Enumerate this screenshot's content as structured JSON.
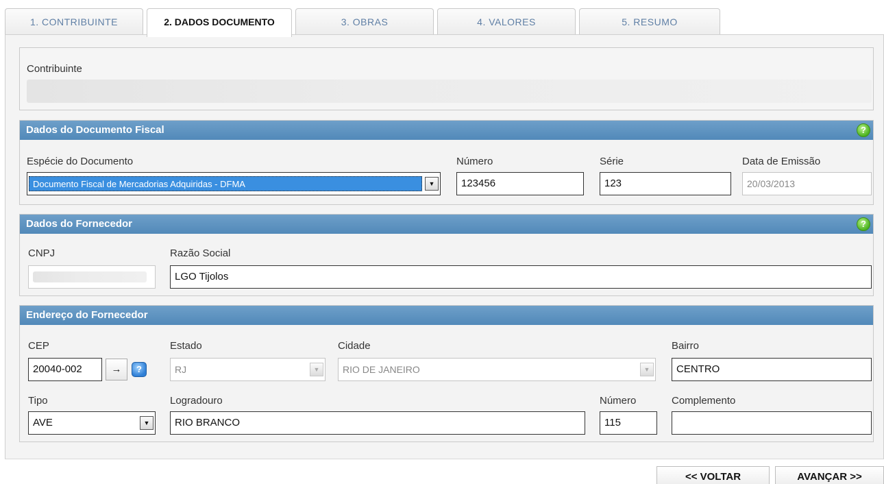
{
  "tabs": [
    {
      "label": "1. CONTRIBUINTE"
    },
    {
      "label": "2. DADOS DOCUMENTO"
    },
    {
      "label": "3. OBRAS"
    },
    {
      "label": "4. VALORES"
    },
    {
      "label": "5. RESUMO"
    }
  ],
  "contribuinte": {
    "label": "Contribuinte",
    "value": ""
  },
  "documento": {
    "header": "Dados do Documento Fiscal",
    "especie_label": "Espécie do Documento",
    "especie_value": "Documento Fiscal de Mercadorias Adquiridas - DFMA",
    "numero_label": "Número",
    "numero_value": "123456",
    "serie_label": "Série",
    "serie_value": "123",
    "data_label": "Data de Emissão",
    "data_value": "20/03/2013"
  },
  "fornecedor": {
    "header": "Dados do Fornecedor",
    "cnpj_label": "CNPJ",
    "cnpj_value": "",
    "razao_label": "Razão Social",
    "razao_value": "LGO Tijolos"
  },
  "endereco": {
    "header": "Endereço do Fornecedor",
    "cep_label": "CEP",
    "cep_value": "20040-002",
    "arrow_label": "→",
    "estado_label": "Estado",
    "estado_value": "RJ",
    "cidade_label": "Cidade",
    "cidade_value": "RIO DE JANEIRO",
    "bairro_label": "Bairro",
    "bairro_value": "CENTRO",
    "tipo_label": "Tipo",
    "tipo_value": "AVE",
    "logradouro_label": "Logradouro",
    "logradouro_value": "RIO BRANCO",
    "numero_label": "Número",
    "numero_value": "115",
    "complemento_label": "Complemento",
    "complemento_value": ""
  },
  "help_glyph": "?",
  "dropdown_glyph": "▼",
  "nav": {
    "back_label": "<< VOLTAR",
    "next_label": "AVANÇAR >>"
  },
  "colors": {
    "section_header": "#5a8fbf",
    "selected_option": "#3a8fe0",
    "tab_text": "#5f7fa5"
  }
}
